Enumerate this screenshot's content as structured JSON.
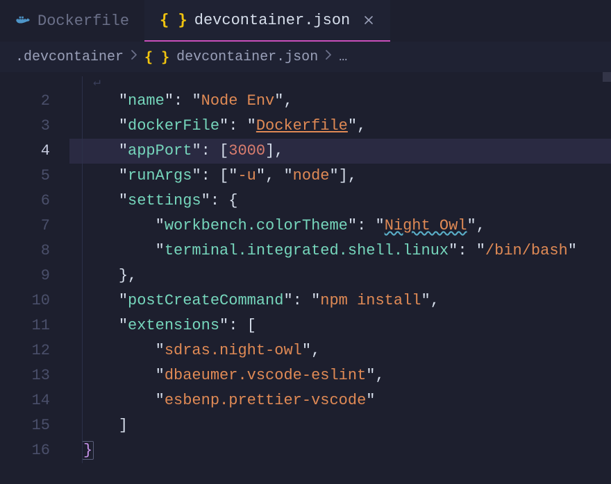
{
  "tabs": [
    {
      "label": "Dockerfile",
      "active": false,
      "icon": "docker-icon"
    },
    {
      "label": "devcontainer.json",
      "active": true,
      "icon": "json-icon",
      "dirty": false
    }
  ],
  "breadcrumbs": {
    "folder": ".devcontainer",
    "file": "devcontainer.json",
    "symbol": "…"
  },
  "editor": {
    "activeLine": 4,
    "lines": [
      {
        "n": 2,
        "tokens": [
          {
            "t": "    ",
            "c": "plain"
          },
          {
            "t": "\"",
            "c": "punc"
          },
          {
            "t": "name",
            "c": "key"
          },
          {
            "t": "\"",
            "c": "punc"
          },
          {
            "t": ": ",
            "c": "punc"
          },
          {
            "t": "\"",
            "c": "punc"
          },
          {
            "t": "Node Env",
            "c": "str"
          },
          {
            "t": "\"",
            "c": "punc"
          },
          {
            "t": ",",
            "c": "punc"
          }
        ]
      },
      {
        "n": 3,
        "tokens": [
          {
            "t": "    ",
            "c": "plain"
          },
          {
            "t": "\"",
            "c": "punc"
          },
          {
            "t": "dockerFile",
            "c": "key"
          },
          {
            "t": "\"",
            "c": "punc"
          },
          {
            "t": ": ",
            "c": "punc"
          },
          {
            "t": "\"",
            "c": "punc"
          },
          {
            "t": "Dockerfile",
            "c": "link"
          },
          {
            "t": "\"",
            "c": "punc"
          },
          {
            "t": ",",
            "c": "punc"
          }
        ]
      },
      {
        "n": 4,
        "tokens": [
          {
            "t": "    ",
            "c": "plain"
          },
          {
            "t": "\"",
            "c": "punc"
          },
          {
            "t": "appPort",
            "c": "key"
          },
          {
            "t": "\"",
            "c": "punc"
          },
          {
            "t": ": [",
            "c": "punc"
          },
          {
            "t": "3000",
            "c": "num"
          },
          {
            "t": "],",
            "c": "punc"
          }
        ]
      },
      {
        "n": 5,
        "tokens": [
          {
            "t": "    ",
            "c": "plain"
          },
          {
            "t": "\"",
            "c": "punc"
          },
          {
            "t": "runArgs",
            "c": "key"
          },
          {
            "t": "\"",
            "c": "punc"
          },
          {
            "t": ": [",
            "c": "punc"
          },
          {
            "t": "\"",
            "c": "punc"
          },
          {
            "t": "-u",
            "c": "str"
          },
          {
            "t": "\"",
            "c": "punc"
          },
          {
            "t": ", ",
            "c": "punc"
          },
          {
            "t": "\"",
            "c": "punc"
          },
          {
            "t": "node",
            "c": "str"
          },
          {
            "t": "\"",
            "c": "punc"
          },
          {
            "t": "],",
            "c": "punc"
          }
        ]
      },
      {
        "n": 6,
        "tokens": [
          {
            "t": "    ",
            "c": "plain"
          },
          {
            "t": "\"",
            "c": "punc"
          },
          {
            "t": "settings",
            "c": "key"
          },
          {
            "t": "\"",
            "c": "punc"
          },
          {
            "t": ": {",
            "c": "punc"
          }
        ]
      },
      {
        "n": 7,
        "tokens": [
          {
            "t": "        ",
            "c": "plain"
          },
          {
            "t": "\"",
            "c": "punc"
          },
          {
            "t": "workbench.colorTheme",
            "c": "key"
          },
          {
            "t": "\"",
            "c": "punc"
          },
          {
            "t": ": ",
            "c": "punc"
          },
          {
            "t": "\"",
            "c": "punc"
          },
          {
            "t": "Night Owl",
            "c": "str wavy"
          },
          {
            "t": "\"",
            "c": "punc"
          },
          {
            "t": ",",
            "c": "punc"
          }
        ]
      },
      {
        "n": 8,
        "tokens": [
          {
            "t": "        ",
            "c": "plain"
          },
          {
            "t": "\"",
            "c": "punc"
          },
          {
            "t": "terminal.integrated.shell.linux",
            "c": "key"
          },
          {
            "t": "\"",
            "c": "punc"
          },
          {
            "t": ": ",
            "c": "punc"
          },
          {
            "t": "\"",
            "c": "punc"
          },
          {
            "t": "/bin/bash",
            "c": "str"
          },
          {
            "t": "\"",
            "c": "punc"
          }
        ]
      },
      {
        "n": 9,
        "tokens": [
          {
            "t": "    ",
            "c": "plain"
          },
          {
            "t": "},",
            "c": "punc"
          }
        ]
      },
      {
        "n": 10,
        "tokens": [
          {
            "t": "    ",
            "c": "plain"
          },
          {
            "t": "\"",
            "c": "punc"
          },
          {
            "t": "postCreateCommand",
            "c": "key"
          },
          {
            "t": "\"",
            "c": "punc"
          },
          {
            "t": ": ",
            "c": "punc"
          },
          {
            "t": "\"",
            "c": "punc"
          },
          {
            "t": "npm install",
            "c": "str"
          },
          {
            "t": "\"",
            "c": "punc"
          },
          {
            "t": ",",
            "c": "punc"
          }
        ]
      },
      {
        "n": 11,
        "tokens": [
          {
            "t": "    ",
            "c": "plain"
          },
          {
            "t": "\"",
            "c": "punc"
          },
          {
            "t": "extensions",
            "c": "key"
          },
          {
            "t": "\"",
            "c": "punc"
          },
          {
            "t": ": [",
            "c": "punc"
          }
        ]
      },
      {
        "n": 12,
        "tokens": [
          {
            "t": "        ",
            "c": "plain"
          },
          {
            "t": "\"",
            "c": "punc"
          },
          {
            "t": "sdras.night-owl",
            "c": "str"
          },
          {
            "t": "\"",
            "c": "punc"
          },
          {
            "t": ",",
            "c": "punc"
          }
        ]
      },
      {
        "n": 13,
        "tokens": [
          {
            "t": "        ",
            "c": "plain"
          },
          {
            "t": "\"",
            "c": "punc"
          },
          {
            "t": "dbaeumer.vscode-eslint",
            "c": "str"
          },
          {
            "t": "\"",
            "c": "punc"
          },
          {
            "t": ",",
            "c": "punc"
          }
        ]
      },
      {
        "n": 14,
        "tokens": [
          {
            "t": "        ",
            "c": "plain"
          },
          {
            "t": "\"",
            "c": "punc"
          },
          {
            "t": "esbenp.prettier-vscode",
            "c": "str"
          },
          {
            "t": "\"",
            "c": "punc"
          }
        ]
      },
      {
        "n": 15,
        "tokens": [
          {
            "t": "    ",
            "c": "plain"
          },
          {
            "t": "]",
            "c": "punc"
          }
        ]
      },
      {
        "n": 16,
        "tokens": [
          {
            "t": "}",
            "c": "brace match"
          }
        ]
      }
    ]
  }
}
